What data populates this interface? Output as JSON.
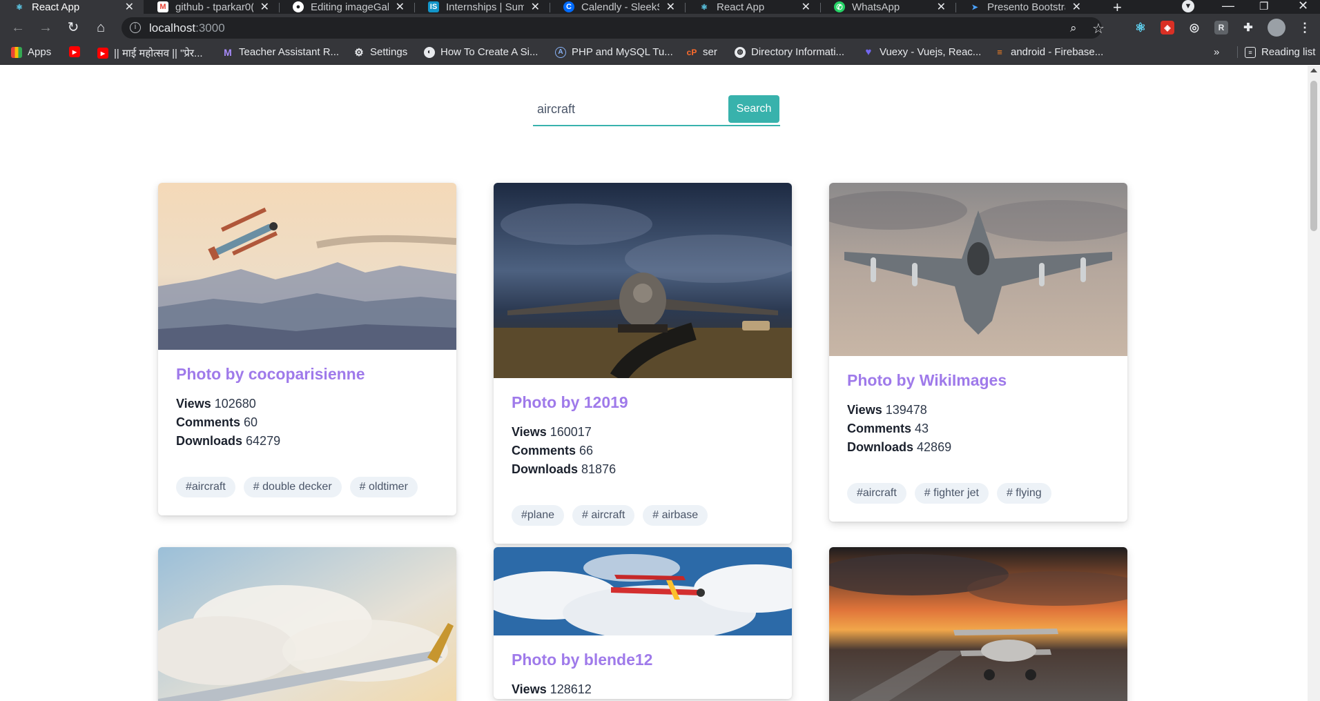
{
  "browser": {
    "tabs": [
      {
        "title": "React App",
        "icon": "react-icon",
        "active": true
      },
      {
        "title": "github - tparkar0(",
        "icon": "gmail-icon"
      },
      {
        "title": "Editing imageGalle",
        "icon": "github-icon"
      },
      {
        "title": "Internships | Sum",
        "icon": "internshala-icon"
      },
      {
        "title": "Calendly - SleekSl",
        "icon": "calendly-icon"
      },
      {
        "title": "React App",
        "icon": "react-icon"
      },
      {
        "title": "WhatsApp",
        "icon": "whatsapp-icon"
      },
      {
        "title": "Presento Bootstra",
        "icon": "presento-icon"
      }
    ],
    "url_host": "localhost",
    "url_port": ":3000",
    "bookmarks": [
      {
        "label": "Apps",
        "icon": "apps-grid-icon"
      },
      {
        "label": "",
        "icon": "youtube-icon"
      },
      {
        "label": "|| माई महोत्सव || \"प्रेर...",
        "icon": "youtube-icon"
      },
      {
        "label": "Teacher Assistant R...",
        "icon": "m-logo-icon"
      },
      {
        "label": "Settings",
        "icon": "gear-icon"
      },
      {
        "label": "How To Create A Si...",
        "icon": "site-icon"
      },
      {
        "label": "PHP and MySQL Tu...",
        "icon": "php-icon"
      },
      {
        "label": "ser",
        "icon": "cpanel-icon"
      },
      {
        "label": "Directory Informati...",
        "icon": "globe-icon"
      },
      {
        "label": "Vuexy - Vuejs, Reac...",
        "icon": "vuexy-icon"
      },
      {
        "label": "android - Firebase...",
        "icon": "stackoverflow-icon"
      }
    ],
    "overflow_label": "»",
    "reading_list": "Reading list"
  },
  "search": {
    "value": "aircraft",
    "button_label": "Search"
  },
  "cards": [
    {
      "title": "Photo by cocoparisienne",
      "views_label": "Views",
      "views": "102680",
      "comments_label": "Comments",
      "comments": "60",
      "downloads_label": "Downloads",
      "downloads": "64279",
      "tags": [
        "#aircraft",
        "# double decker",
        "# oldtimer"
      ],
      "image": "biplane-over-mountains"
    },
    {
      "title": "Photo by 12019",
      "views_label": "Views",
      "views": "160017",
      "comments_label": "Comments",
      "comments": "66",
      "downloads_label": "Downloads",
      "downloads": "81876",
      "tags": [
        "#plane",
        "# aircraft",
        "# airbase"
      ],
      "image": "cargo-plane-night-airbase"
    },
    {
      "title": "Photo by WikiImages",
      "views_label": "Views",
      "views": "139478",
      "comments_label": "Comments",
      "comments": "43",
      "downloads_label": "Downloads",
      "downloads": "42869",
      "tags": [
        "#aircraft",
        "# fighter jet",
        "# flying"
      ],
      "image": "fighter-jet"
    },
    {
      "title": "",
      "image": "wing-above-clouds"
    },
    {
      "title": "Photo by blende12",
      "views_label": "Views",
      "views": "128612",
      "image": "red-plane-clouds"
    },
    {
      "title": "",
      "image": "biplane-sunset-runway"
    }
  ],
  "colors": {
    "accent": "#38b2ac",
    "title": "#9f7aea",
    "tag_bg": "#edf2f7"
  }
}
